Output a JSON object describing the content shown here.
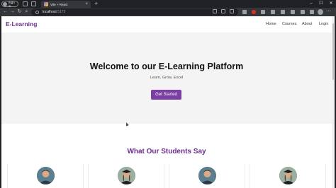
{
  "browser": {
    "signin_label": "Sign in",
    "tab_title": "Vite + React",
    "new_tab_glyph": "+",
    "url_host": "localhost",
    "url_port": ":5173"
  },
  "site": {
    "brand": "E-Learning",
    "nav": [
      "Home",
      "Courses",
      "About",
      "Login"
    ]
  },
  "hero": {
    "title": "Welcome to our E-Learning Platform",
    "subtitle": "Learn, Grow, Excel",
    "cta_label": "Get Started"
  },
  "testimonials": {
    "title": "What Our Students Say",
    "avatars": [
      {
        "icon": "student-avatar-male"
      },
      {
        "icon": "student-avatar-graduate"
      },
      {
        "icon": "student-avatar-male"
      },
      {
        "icon": "student-avatar-graduate"
      }
    ]
  },
  "colors": {
    "brand": "#6b2d91",
    "button": "#7b3ea3",
    "hero_bg": "#f4f4f4"
  }
}
